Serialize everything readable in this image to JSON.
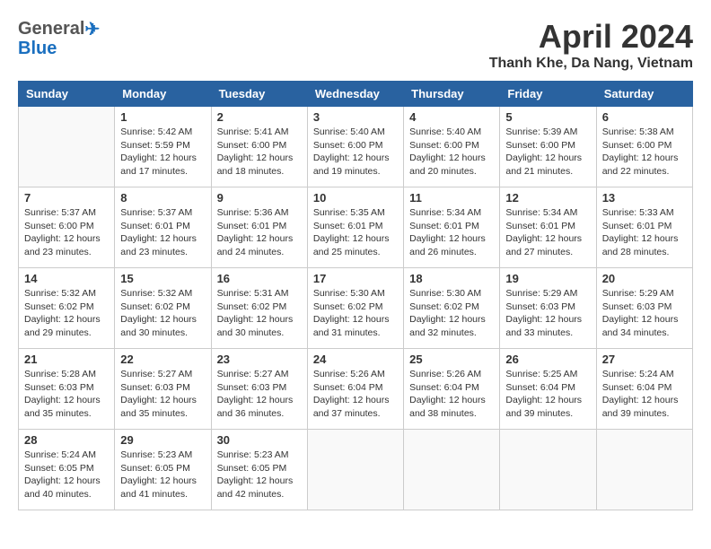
{
  "header": {
    "logo_general": "General",
    "logo_blue": "Blue",
    "month_title": "April 2024",
    "location": "Thanh Khe, Da Nang, Vietnam"
  },
  "days_of_week": [
    "Sunday",
    "Monday",
    "Tuesday",
    "Wednesday",
    "Thursday",
    "Friday",
    "Saturday"
  ],
  "weeks": [
    [
      {
        "day": "",
        "info": ""
      },
      {
        "day": "1",
        "info": "Sunrise: 5:42 AM\nSunset: 5:59 PM\nDaylight: 12 hours\nand 17 minutes."
      },
      {
        "day": "2",
        "info": "Sunrise: 5:41 AM\nSunset: 6:00 PM\nDaylight: 12 hours\nand 18 minutes."
      },
      {
        "day": "3",
        "info": "Sunrise: 5:40 AM\nSunset: 6:00 PM\nDaylight: 12 hours\nand 19 minutes."
      },
      {
        "day": "4",
        "info": "Sunrise: 5:40 AM\nSunset: 6:00 PM\nDaylight: 12 hours\nand 20 minutes."
      },
      {
        "day": "5",
        "info": "Sunrise: 5:39 AM\nSunset: 6:00 PM\nDaylight: 12 hours\nand 21 minutes."
      },
      {
        "day": "6",
        "info": "Sunrise: 5:38 AM\nSunset: 6:00 PM\nDaylight: 12 hours\nand 22 minutes."
      }
    ],
    [
      {
        "day": "7",
        "info": "Sunrise: 5:37 AM\nSunset: 6:00 PM\nDaylight: 12 hours\nand 23 minutes."
      },
      {
        "day": "8",
        "info": "Sunrise: 5:37 AM\nSunset: 6:01 PM\nDaylight: 12 hours\nand 23 minutes."
      },
      {
        "day": "9",
        "info": "Sunrise: 5:36 AM\nSunset: 6:01 PM\nDaylight: 12 hours\nand 24 minutes."
      },
      {
        "day": "10",
        "info": "Sunrise: 5:35 AM\nSunset: 6:01 PM\nDaylight: 12 hours\nand 25 minutes."
      },
      {
        "day": "11",
        "info": "Sunrise: 5:34 AM\nSunset: 6:01 PM\nDaylight: 12 hours\nand 26 minutes."
      },
      {
        "day": "12",
        "info": "Sunrise: 5:34 AM\nSunset: 6:01 PM\nDaylight: 12 hours\nand 27 minutes."
      },
      {
        "day": "13",
        "info": "Sunrise: 5:33 AM\nSunset: 6:01 PM\nDaylight: 12 hours\nand 28 minutes."
      }
    ],
    [
      {
        "day": "14",
        "info": "Sunrise: 5:32 AM\nSunset: 6:02 PM\nDaylight: 12 hours\nand 29 minutes."
      },
      {
        "day": "15",
        "info": "Sunrise: 5:32 AM\nSunset: 6:02 PM\nDaylight: 12 hours\nand 30 minutes."
      },
      {
        "day": "16",
        "info": "Sunrise: 5:31 AM\nSunset: 6:02 PM\nDaylight: 12 hours\nand 30 minutes."
      },
      {
        "day": "17",
        "info": "Sunrise: 5:30 AM\nSunset: 6:02 PM\nDaylight: 12 hours\nand 31 minutes."
      },
      {
        "day": "18",
        "info": "Sunrise: 5:30 AM\nSunset: 6:02 PM\nDaylight: 12 hours\nand 32 minutes."
      },
      {
        "day": "19",
        "info": "Sunrise: 5:29 AM\nSunset: 6:03 PM\nDaylight: 12 hours\nand 33 minutes."
      },
      {
        "day": "20",
        "info": "Sunrise: 5:29 AM\nSunset: 6:03 PM\nDaylight: 12 hours\nand 34 minutes."
      }
    ],
    [
      {
        "day": "21",
        "info": "Sunrise: 5:28 AM\nSunset: 6:03 PM\nDaylight: 12 hours\nand 35 minutes."
      },
      {
        "day": "22",
        "info": "Sunrise: 5:27 AM\nSunset: 6:03 PM\nDaylight: 12 hours\nand 35 minutes."
      },
      {
        "day": "23",
        "info": "Sunrise: 5:27 AM\nSunset: 6:03 PM\nDaylight: 12 hours\nand 36 minutes."
      },
      {
        "day": "24",
        "info": "Sunrise: 5:26 AM\nSunset: 6:04 PM\nDaylight: 12 hours\nand 37 minutes."
      },
      {
        "day": "25",
        "info": "Sunrise: 5:26 AM\nSunset: 6:04 PM\nDaylight: 12 hours\nand 38 minutes."
      },
      {
        "day": "26",
        "info": "Sunrise: 5:25 AM\nSunset: 6:04 PM\nDaylight: 12 hours\nand 39 minutes."
      },
      {
        "day": "27",
        "info": "Sunrise: 5:24 AM\nSunset: 6:04 PM\nDaylight: 12 hours\nand 39 minutes."
      }
    ],
    [
      {
        "day": "28",
        "info": "Sunrise: 5:24 AM\nSunset: 6:05 PM\nDaylight: 12 hours\nand 40 minutes."
      },
      {
        "day": "29",
        "info": "Sunrise: 5:23 AM\nSunset: 6:05 PM\nDaylight: 12 hours\nand 41 minutes."
      },
      {
        "day": "30",
        "info": "Sunrise: 5:23 AM\nSunset: 6:05 PM\nDaylight: 12 hours\nand 42 minutes."
      },
      {
        "day": "",
        "info": ""
      },
      {
        "day": "",
        "info": ""
      },
      {
        "day": "",
        "info": ""
      },
      {
        "day": "",
        "info": ""
      }
    ]
  ]
}
